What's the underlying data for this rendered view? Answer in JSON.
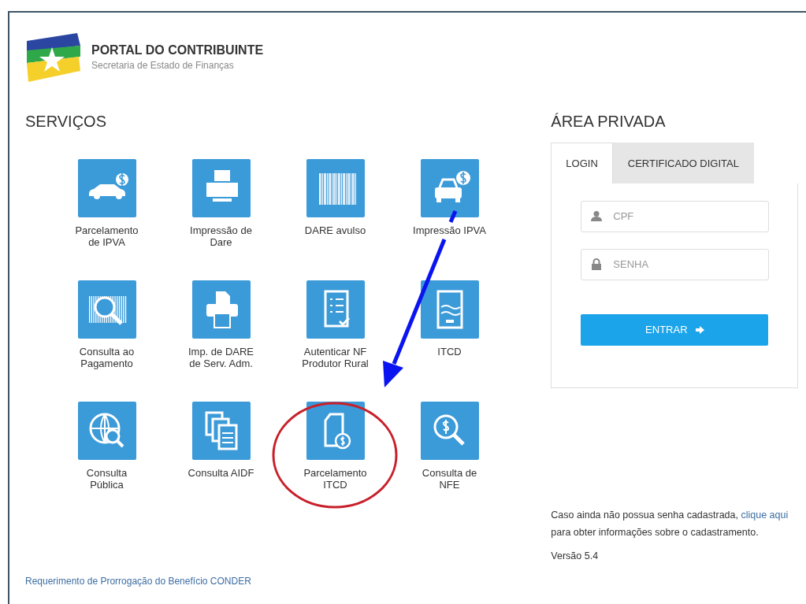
{
  "header": {
    "title": "PORTAL DO CONTRIBUINTE",
    "subtitle": "Secretaria de Estado de Finanças"
  },
  "services": {
    "heading": "SERVIÇOS",
    "items": [
      {
        "label": "Parcelamento\nde IPVA"
      },
      {
        "label": "Impressão de\nDare"
      },
      {
        "label": "DARE avulso"
      },
      {
        "label": "Impressão IPVA"
      },
      {
        "label": "Consulta ao\nPagamento"
      },
      {
        "label": "Imp. de DARE\nde Serv. Adm."
      },
      {
        "label": "Autenticar NF\nProdutor Rural"
      },
      {
        "label": "ITCD"
      },
      {
        "label": "Consulta\nPública"
      },
      {
        "label": "Consulta AIDF"
      },
      {
        "label": "Parcelamento\nITCD"
      },
      {
        "label": "Consulta de\nNFE"
      }
    ]
  },
  "footer_link": "Requerimento de Prorrogação do Benefício CONDER",
  "private_area": {
    "heading": "ÁREA PRIVADA",
    "tabs": [
      {
        "label": "LOGIN",
        "selected": true
      },
      {
        "label": "CERTIFICADO DIGITAL",
        "selected": false
      }
    ],
    "fields": [
      {
        "kind": "user",
        "placeholder": "CPF"
      },
      {
        "kind": "password",
        "placeholder": "SENHA"
      }
    ],
    "button": "ENTRAR",
    "info": {
      "before": "Caso ainda não possua senha cadastrada,",
      "link": "clique aqui",
      "after": "para obter informações sobre o cadastramento."
    },
    "version": "Versão 5.4"
  }
}
